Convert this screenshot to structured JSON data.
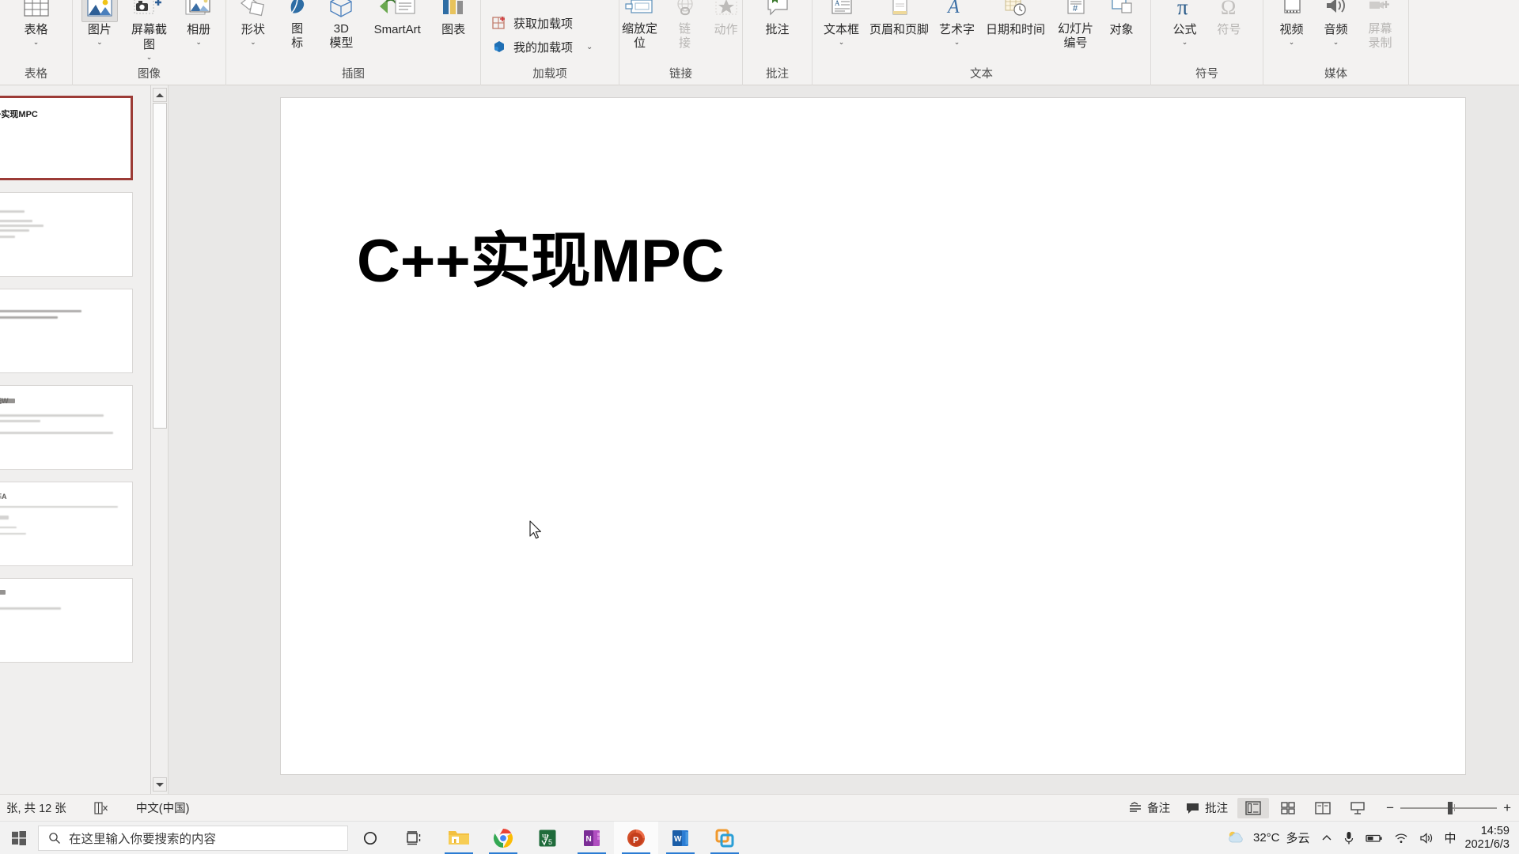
{
  "ribbon": {
    "groups": [
      {
        "label": "表格",
        "items": [
          {
            "name": "table",
            "label": "表格",
            "icon": "table-icon",
            "chevron": true,
            "disabled": false
          }
        ]
      },
      {
        "label": "图像",
        "items": [
          {
            "name": "pictures",
            "label": "图片",
            "icon": "picture-icon",
            "chevron": true,
            "disabled": false,
            "selected": true
          },
          {
            "name": "screenshot",
            "label": "屏幕截图",
            "icon": "screenshot-icon",
            "chevron": true,
            "disabled": false
          },
          {
            "name": "photo-album",
            "label": "相册",
            "icon": "photo-album-icon",
            "chevron": true,
            "disabled": false
          }
        ]
      },
      {
        "label": "插图",
        "items": [
          {
            "name": "shapes",
            "label": "形状",
            "icon": "shapes-icon",
            "chevron": true,
            "disabled": false
          },
          {
            "name": "icons",
            "label": "图\n标",
            "icon": "icons-icon",
            "chevron": false,
            "disabled": false
          },
          {
            "name": "model-3d",
            "label": "3D\n模型",
            "icon": "cube-icon",
            "chevron": false,
            "disabled": false
          },
          {
            "name": "smartart",
            "label": "SmartArt",
            "icon": "smartart-icon",
            "chevron": false,
            "disabled": false
          },
          {
            "name": "chart",
            "label": "图表",
            "icon": "chart-icon",
            "chevron": false,
            "disabled": false
          }
        ]
      },
      {
        "label": "加载项",
        "inline": [
          {
            "name": "get-addins",
            "label": "获取加载项",
            "icon": "store-icon",
            "chevron": false
          },
          {
            "name": "my-addins",
            "label": "我的加载项",
            "icon": "addins-icon",
            "chevron": true
          }
        ]
      },
      {
        "label": "链接",
        "items": [
          {
            "name": "zoom-locate",
            "label": "缩放定\n位",
            "icon": "zoom-locate-icon",
            "chevron": true,
            "disabled": false,
            "inlinechev": true
          },
          {
            "name": "link",
            "label": "链\n接",
            "icon": "link-icon",
            "chevron": false,
            "disabled": true
          },
          {
            "name": "action",
            "label": "动作",
            "icon": "action-star-icon",
            "chevron": false,
            "disabled": true
          }
        ]
      },
      {
        "label": "批注",
        "items": [
          {
            "name": "comment",
            "label": "批注",
            "icon": "comment-icon",
            "chevron": false,
            "disabled": false
          }
        ]
      },
      {
        "label": "文本",
        "items": [
          {
            "name": "text-box",
            "label": "文本框",
            "icon": "textbox-icon",
            "chevron": true,
            "disabled": false
          },
          {
            "name": "header-footer",
            "label": "页眉和页脚",
            "icon": "header-footer-icon",
            "chevron": false,
            "disabled": false
          },
          {
            "name": "wordart",
            "label": "艺术字",
            "icon": "wordart-icon",
            "chevron": true,
            "disabled": false
          },
          {
            "name": "date-time",
            "label": "日期和时间",
            "icon": "date-time-icon",
            "chevron": false,
            "disabled": false
          },
          {
            "name": "slide-number",
            "label": "幻灯片\n编号",
            "icon": "slide-number-icon",
            "chevron": false,
            "disabled": false
          },
          {
            "name": "object",
            "label": "对象",
            "icon": "object-icon",
            "chevron": false,
            "disabled": false
          }
        ]
      },
      {
        "label": "符号",
        "items": [
          {
            "name": "equation",
            "label": "公式",
            "icon": "equation-pi-icon",
            "chevron": true,
            "disabled": false
          },
          {
            "name": "symbol",
            "label": "符号",
            "icon": "symbol-omega-icon",
            "chevron": false,
            "disabled": true
          }
        ]
      },
      {
        "label": "媒体",
        "items": [
          {
            "name": "video",
            "label": "视频",
            "icon": "video-icon",
            "chevron": true,
            "disabled": false
          },
          {
            "name": "audio",
            "label": "音频",
            "icon": "audio-icon",
            "chevron": true,
            "disabled": false
          },
          {
            "name": "screen-recording",
            "label": "屏幕\n录制",
            "icon": "screen-record-icon",
            "chevron": false,
            "disabled": true
          }
        ]
      }
    ]
  },
  "thumbnails": [
    {
      "index": 1,
      "title": "+实现MPC",
      "active": true
    },
    {
      "index": 2,
      "title": "",
      "active": false
    },
    {
      "index": 3,
      "title": "",
      "active": false
    },
    {
      "index": 4,
      "title": "迭W",
      "active": false
    },
    {
      "index": 5,
      "title": "阵A",
      "active": false
    },
    {
      "index": 6,
      "title": "",
      "active": false
    }
  ],
  "slide": {
    "title": "C++实现MPC"
  },
  "status": {
    "slide_count_text": "张, 共 12 张",
    "accessibility_icon": "accessibility-check-icon",
    "language": "中文(中国)",
    "notes_label": "备注",
    "comments_label": "批注",
    "views": [
      {
        "name": "normal-view",
        "icon": "normal-view-icon",
        "active": true
      },
      {
        "name": "slide-sorter-view",
        "icon": "slide-sorter-icon",
        "active": false
      },
      {
        "name": "reading-view",
        "icon": "reading-view-icon",
        "active": false
      },
      {
        "name": "slideshow-view",
        "icon": "slideshow-icon",
        "active": false
      }
    ],
    "zoom_minus": "−",
    "zoom_plus": "+"
  },
  "taskbar": {
    "start_icon": "windows-start-icon",
    "search_icon": "search-icon",
    "search_placeholder": "在这里输入你要搜索的内容",
    "cortana_icon": "cortana-icon",
    "taskview_icon": "task-view-icon",
    "apps": [
      {
        "name": "file-explorer",
        "icon": "file-explorer-icon",
        "running": true,
        "active": false
      },
      {
        "name": "google-chrome",
        "icon": "chrome-icon",
        "running": true,
        "active": false
      },
      {
        "name": "mathtype",
        "icon": "mathtype-icon",
        "running": false,
        "active": false
      },
      {
        "name": "onenote",
        "icon": "onenote-icon",
        "running": true,
        "active": false
      },
      {
        "name": "powerpoint",
        "icon": "powerpoint-icon",
        "running": true,
        "active": true
      },
      {
        "name": "word",
        "icon": "word-icon",
        "running": true,
        "active": false
      },
      {
        "name": "vmware",
        "icon": "vmware-icon",
        "running": true,
        "active": false
      }
    ],
    "tray": {
      "weather_icon": "weather-partly-cloudy-icon",
      "temperature": "32°C",
      "weather_text": "多云",
      "chevron_icon": "chevron-up-icon",
      "mic_icon": "microphone-icon",
      "battery_icon": "battery-icon",
      "wifi_icon": "wifi-icon",
      "volume_icon": "volume-icon",
      "ime_label": "中",
      "time": "14:59",
      "date": "2021/6/3"
    }
  }
}
